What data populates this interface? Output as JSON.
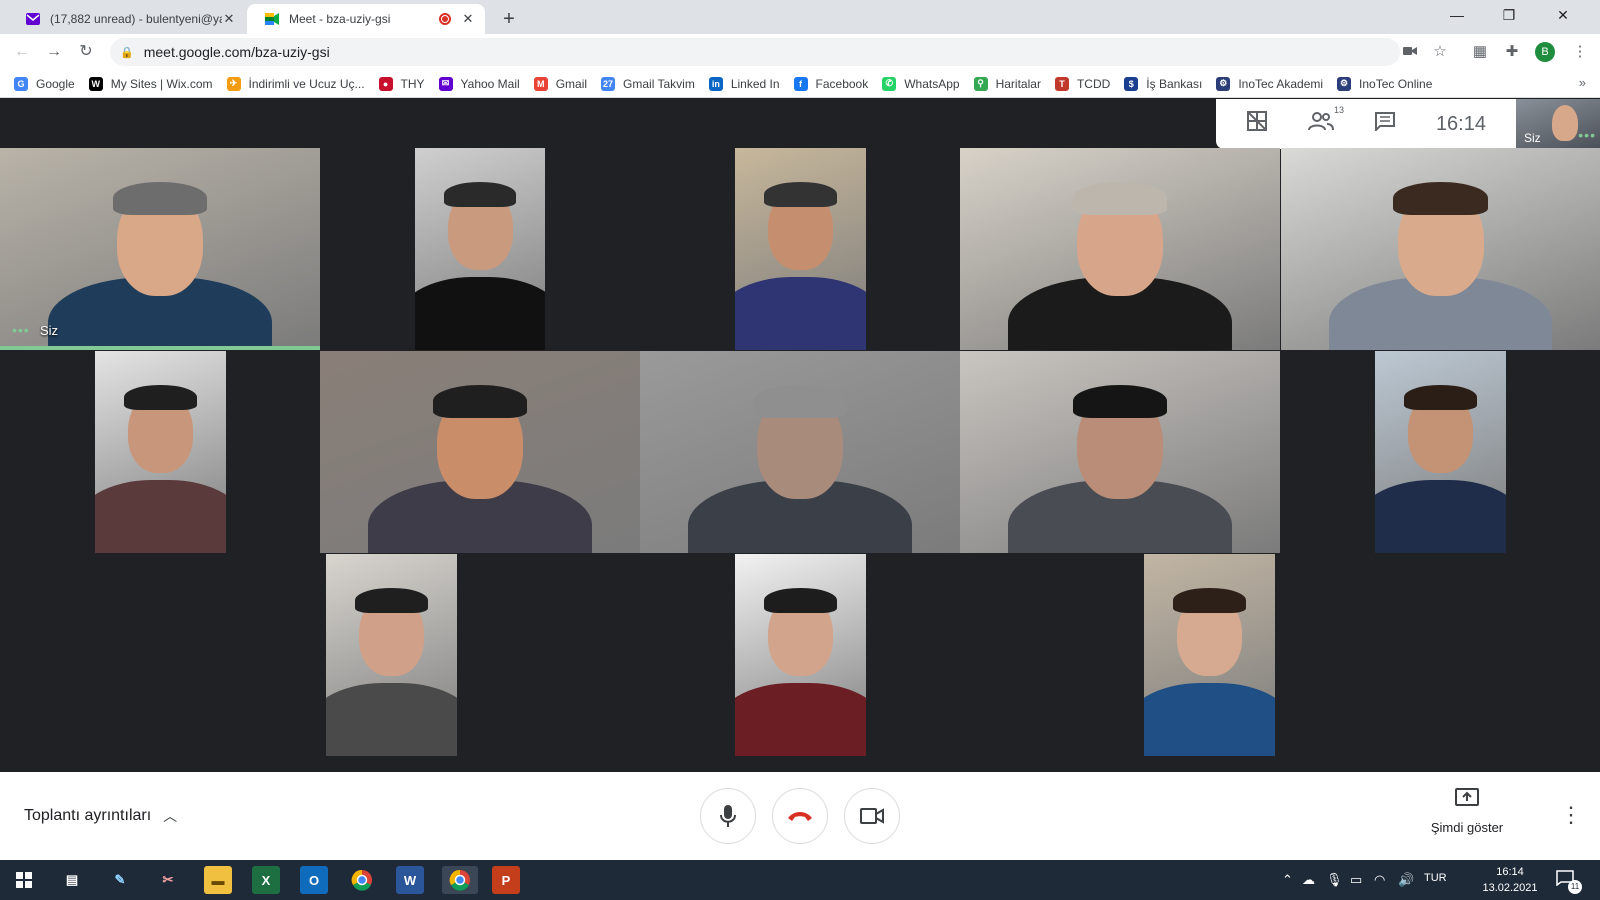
{
  "browser": {
    "tabs": [
      {
        "title": "(17,882 unread) - bulentyeni@ya",
        "close": "✕"
      },
      {
        "title": "Meet - bza-uziy-gsi",
        "close": "✕"
      }
    ],
    "new_tab": "+",
    "window_controls": {
      "minimize": "—",
      "restore": "❐",
      "close": "✕"
    },
    "url": "meet.google.com/bza-uziy-gsi",
    "profile_initial": "B",
    "bookmarks": [
      {
        "label": "Google",
        "icon": "google-icon",
        "color": "#4285f4",
        "glyph": "G"
      },
      {
        "label": "My Sites | Wix.com",
        "icon": "wix-icon",
        "color": "#000000",
        "glyph": "W"
      },
      {
        "label": "İndirimli ve Ucuz Uç...",
        "icon": "plane-icon",
        "color": "#f39c12",
        "glyph": "✈"
      },
      {
        "label": "THY",
        "icon": "thy-icon",
        "color": "#c8102e",
        "glyph": "●"
      },
      {
        "label": "Yahoo Mail",
        "icon": "yahoo-mail-icon",
        "color": "#6001d2",
        "glyph": "✉"
      },
      {
        "label": "Gmail",
        "icon": "gmail-icon",
        "color": "#ea4335",
        "glyph": "M"
      },
      {
        "label": "Gmail Takvim",
        "icon": "calendar-icon",
        "color": "#4285f4",
        "glyph": "27"
      },
      {
        "label": "Linked In",
        "icon": "linkedin-icon",
        "color": "#0a66c2",
        "glyph": "in"
      },
      {
        "label": "Facebook",
        "icon": "facebook-icon",
        "color": "#1877f2",
        "glyph": "f"
      },
      {
        "label": "WhatsApp",
        "icon": "whatsapp-icon",
        "color": "#25d366",
        "glyph": "✆"
      },
      {
        "label": "Haritalar",
        "icon": "maps-icon",
        "color": "#34a853",
        "glyph": "⚲"
      },
      {
        "label": "TCDD",
        "icon": "tcdd-icon",
        "color": "#c0392b",
        "glyph": "T"
      },
      {
        "label": "İş Bankası",
        "icon": "isbank-icon",
        "color": "#1a3f8f",
        "glyph": "$"
      },
      {
        "label": "InoTec Akademi",
        "icon": "inotec-icon",
        "color": "#2c3e7a",
        "glyph": "⚙"
      },
      {
        "label": "InoTec Online",
        "icon": "inotec-icon",
        "color": "#2c3e7a",
        "glyph": "⚙"
      }
    ],
    "bookmarks_more": "»"
  },
  "meet": {
    "participant_count": "13",
    "time": "16:14",
    "self_label": "Siz",
    "tiles": [
      {
        "id": "self",
        "label": "Siz",
        "speaking": true,
        "bg": "#b9b3a8",
        "skin": "#d8a888",
        "hair": "#6d6d6d",
        "shirt": "#1f3d5a"
      },
      {
        "id": "p2",
        "bg": "#cfcfcf",
        "skin": "#c99a7e",
        "hair": "#2a2a2a",
        "shirt": "#111111"
      },
      {
        "id": "p3",
        "bg": "#c7b79b",
        "skin": "#c58f6f",
        "hair": "#333333",
        "shirt": "#2f3573"
      },
      {
        "id": "p4",
        "bg": "#d8d2c8",
        "skin": "#d6a58a",
        "hair": "#bdb6ad",
        "shirt": "#1b1b1b"
      },
      {
        "id": "p5",
        "bg": "#d9d9d6",
        "skin": "#d9ab8c",
        "hair": "#3a2a20",
        "shirt": "#7f8897"
      },
      {
        "id": "p6",
        "bg": "#e4e4e4",
        "skin": "#c8967a",
        "hair": "#1f1f1f",
        "shirt": "#5a3a3a"
      },
      {
        "id": "p7",
        "bg": "#8a7f78",
        "skin": "#c98d6a",
        "hair": "#1f1f1f",
        "shirt": "#3d3c48"
      },
      {
        "id": "p8",
        "bg": "#9a9a9a",
        "skin": "#a88b7b",
        "hair": "#8f8f8f",
        "shirt": "#3b3f48"
      },
      {
        "id": "p9",
        "bg": "#c9c5c0",
        "skin": "#b98d77",
        "hair": "#151515",
        "shirt": "#4a4c54"
      },
      {
        "id": "p10",
        "bg": "#bcc8d3",
        "skin": "#c49274",
        "hair": "#2a1e17",
        "shirt": "#1f2d4a"
      },
      {
        "id": "p11",
        "bg": "#d8d5cf",
        "skin": "#d0a089",
        "hair": "#1f1f1f",
        "shirt": "#4a4a4a"
      },
      {
        "id": "p12",
        "bg": "#f2f2f2",
        "skin": "#d2a48c",
        "hair": "#1d1d1d",
        "shirt": "#6b1f24"
      },
      {
        "id": "p13",
        "bg": "#c2b6a4",
        "skin": "#d6aa91",
        "hair": "#2c2018",
        "shirt": "#1f4f84"
      }
    ]
  },
  "bottom": {
    "details_label": "Toplantı ayrıntıları",
    "present_label": "Şimdi göster"
  },
  "taskbar": {
    "lang": "TUR",
    "time": "16:14",
    "date": "13.02.2021",
    "notifications": "11",
    "apps": [
      "windows-start",
      "task-view",
      "paint",
      "snipping",
      "file-explorer",
      "excel",
      "outlook",
      "chrome",
      "word",
      "chrome-profile",
      "powerpoint"
    ]
  }
}
